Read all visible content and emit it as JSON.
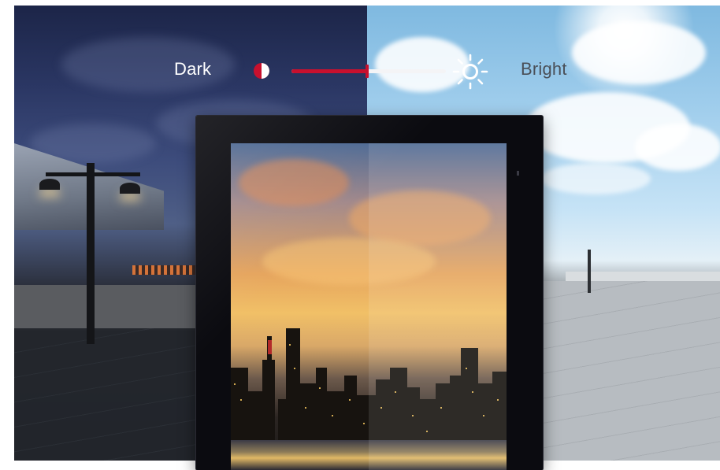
{
  "slider": {
    "label_dark": "Dark",
    "label_bright": "Bright",
    "value_fraction": 0.49,
    "dark_icon": "contrast-half-circle-icon",
    "bright_icon": "sun-icon",
    "accent_color": "#c8102e"
  }
}
